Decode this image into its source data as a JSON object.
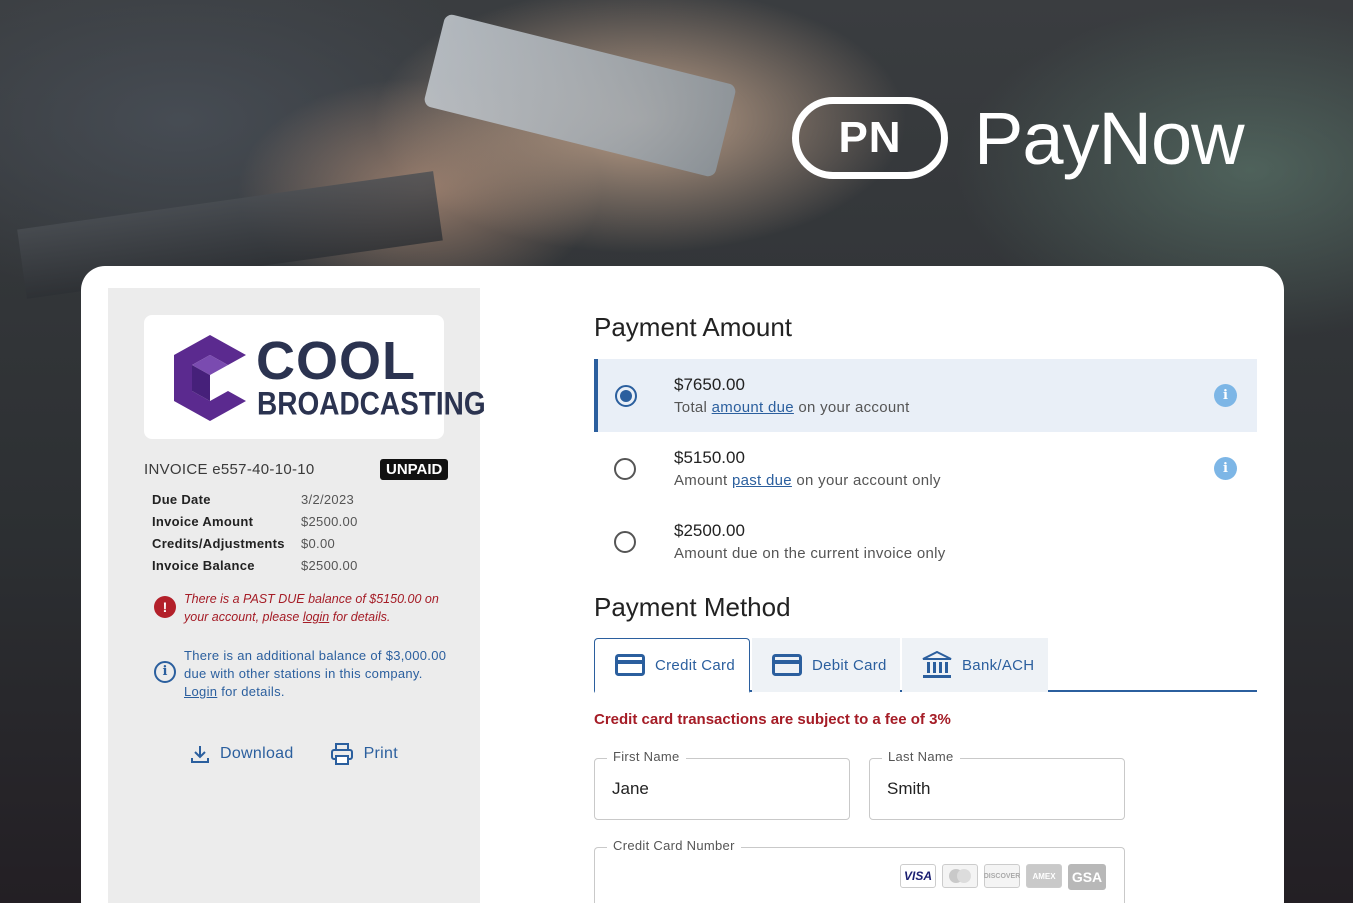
{
  "brand": {
    "mark": "PN",
    "name": "PayNow"
  },
  "company": {
    "line1": "COOL",
    "line2": "BROADCASTING"
  },
  "invoice": {
    "title": "INVOICE e557-40-10-10",
    "status": "UNPAID",
    "rows": [
      {
        "label": "Due Date",
        "value": "3/2/2023"
      },
      {
        "label": "Invoice Amount",
        "value": "$2500.00"
      },
      {
        "label": "Credits/Adjustments",
        "value": "$0.00"
      },
      {
        "label": "Invoice Balance",
        "value": "$2500.00"
      }
    ]
  },
  "alerts": {
    "past_due": {
      "icon": "exclamation-icon",
      "prefix": "There is a PAST DUE balance of $5150.00 on your account, please ",
      "link": "login",
      "suffix": " for details."
    },
    "additional": {
      "icon": "info-icon",
      "prefix": "There is an additional balance of $3,000.00 due with other stations in this company. ",
      "link": "Login",
      "suffix": " for details."
    }
  },
  "actions": {
    "download": "Download",
    "print": "Print"
  },
  "payment_amount": {
    "title": "Payment Amount",
    "options": [
      {
        "amount": "$7650.00",
        "desc_prefix": "Total ",
        "desc_link": "amount due",
        "desc_suffix": " on your account",
        "selected": true
      },
      {
        "amount": "$5150.00",
        "desc_prefix": "Amount ",
        "desc_link": "past due",
        "desc_suffix": " on your account only",
        "selected": false
      },
      {
        "amount": "$2500.00",
        "desc_prefix": "Amount due on the current invoice only",
        "desc_link": "",
        "desc_suffix": "",
        "selected": false
      }
    ]
  },
  "payment_method": {
    "title": "Payment Method",
    "tabs": [
      {
        "label": "Credit Card",
        "icon": "credit-card-icon",
        "active": true
      },
      {
        "label": "Debit Card",
        "icon": "debit-card-icon",
        "active": false
      },
      {
        "label": "Bank/ACH",
        "icon": "bank-icon",
        "active": false
      }
    ],
    "fee_note": "Credit card transactions are subject to a fee of 3%"
  },
  "form": {
    "first_name_label": "First Name",
    "first_name_value": "Jane",
    "last_name_label": "Last Name",
    "last_name_value": "Smith",
    "card_number_label": "Credit Card Number",
    "card_brands": [
      "VISA",
      "MC",
      "DISCOVER",
      "AMEX",
      "GSA"
    ]
  },
  "colors": {
    "accent": "#2b5f9e",
    "error": "#a51c26",
    "logo_purple": "#5b2a8f",
    "logo_navy": "#2b3350"
  }
}
